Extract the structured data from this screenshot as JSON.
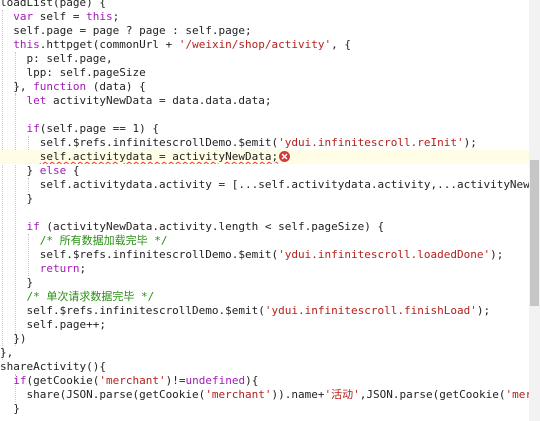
{
  "editor": {
    "lines": [
      [
        {
          "t": "loadList(page) {"
        }
      ],
      [
        {
          "t": "  "
        },
        {
          "t": "var",
          "c": "kw"
        },
        {
          "t": " self = "
        },
        {
          "t": "this",
          "c": "kw"
        },
        {
          "t": ";"
        }
      ],
      [
        {
          "t": "  self.page = page ? page : self.page;"
        }
      ],
      [
        {
          "t": "  "
        },
        {
          "t": "this",
          "c": "kw"
        },
        {
          "t": ".httpget(commonUrl + "
        },
        {
          "t": "'/weixin/shop/activity'",
          "c": "str"
        },
        {
          "t": ", {"
        }
      ],
      [
        {
          "t": "    p: self.page,"
        }
      ],
      [
        {
          "t": "    lpp: self.pageSize"
        }
      ],
      [
        {
          "t": "  }, "
        },
        {
          "t": "function",
          "c": "kw"
        },
        {
          "t": " (data) {"
        }
      ],
      [
        {
          "t": "    "
        },
        {
          "t": "let",
          "c": "kw"
        },
        {
          "t": " activityNewData = data.data.data;"
        }
      ],
      [
        {
          "t": ""
        }
      ],
      [
        {
          "t": "    "
        },
        {
          "t": "if",
          "c": "kw"
        },
        {
          "t": "(self.page == 1) {"
        }
      ],
      [
        {
          "t": "      self.$refs.infinitescrollDemo.$emit("
        },
        {
          "t": "'ydui.infinitescroll.reInit'",
          "c": "str"
        },
        {
          "t": ");"
        }
      ],
      [
        {
          "t": "      "
        },
        {
          "t": "self.activitydata = activityNewData;",
          "c": "err"
        },
        {
          "t": "",
          "c": "erricon"
        }
      ],
      [
        {
          "t": "    } "
        },
        {
          "t": "else",
          "c": "kw"
        },
        {
          "t": " {"
        }
      ],
      [
        {
          "t": "      self.activitydata.activity = [...self.activitydata.activity,...activityNewData.activity];"
        }
      ],
      [
        {
          "t": "    }"
        }
      ],
      [
        {
          "t": ""
        }
      ],
      [
        {
          "t": "    "
        },
        {
          "t": "if",
          "c": "kw"
        },
        {
          "t": " (activityNewData.activity.length < self.pageSize) {"
        }
      ],
      [
        {
          "t": "      "
        },
        {
          "t": "/* 所有数据加载完毕 */",
          "c": "cm"
        }
      ],
      [
        {
          "t": "      self.$refs.infinitescrollDemo.$emit("
        },
        {
          "t": "'ydui.infinitescroll.loadedDone'",
          "c": "str"
        },
        {
          "t": ");"
        }
      ],
      [
        {
          "t": "      "
        },
        {
          "t": "return",
          "c": "kw"
        },
        {
          "t": ";"
        }
      ],
      [
        {
          "t": "    }"
        }
      ],
      [
        {
          "t": "    "
        },
        {
          "t": "/* 单次请求数据完毕 */",
          "c": "cm"
        }
      ],
      [
        {
          "t": "    self.$refs.infinitescrollDemo.$emit("
        },
        {
          "t": "'ydui.infinitescroll.finishLoad'",
          "c": "str"
        },
        {
          "t": ");"
        }
      ],
      [
        {
          "t": "    self.page++;"
        }
      ],
      [
        {
          "t": "  })"
        }
      ],
      [
        {
          "t": "},"
        }
      ],
      [
        {
          "t": "shareActivity(){"
        }
      ],
      [
        {
          "t": "  "
        },
        {
          "t": "if",
          "c": "kw"
        },
        {
          "t": "(getCookie("
        },
        {
          "t": "'merchant'",
          "c": "str"
        },
        {
          "t": ")!="
        },
        {
          "t": "undefined",
          "c": "kw"
        },
        {
          "t": "){"
        }
      ],
      [
        {
          "t": "    share(JSON.parse(getCookie("
        },
        {
          "t": "'merchant'",
          "c": "str"
        },
        {
          "t": ")).name+"
        },
        {
          "t": "'活动'",
          "c": "str"
        },
        {
          "t": ",JSON.parse(getCookie("
        },
        {
          "t": "'merchant'",
          "c": "str"
        },
        {
          "t": "))"
        }
      ],
      [
        {
          "t": "  }"
        }
      ]
    ]
  },
  "scrollbar": {
    "position_fraction": 0.58
  }
}
